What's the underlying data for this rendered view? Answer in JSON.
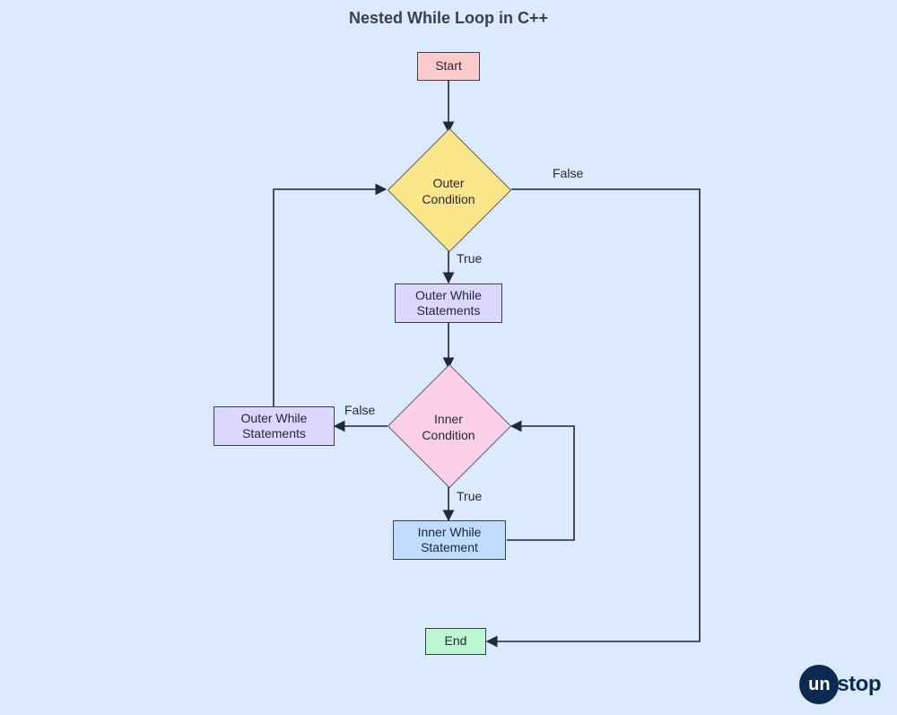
{
  "title": "Nested While Loop in C++",
  "nodes": {
    "start": "Start",
    "outer_condition": "Outer\nCondition",
    "outer_while_stmts_top": "Outer While\nStatements",
    "inner_condition": "Inner\nCondition",
    "outer_while_stmts_left": "Outer While\nStatements",
    "inner_while_stmt": "Inner While\nStatement",
    "end": "End"
  },
  "edges": {
    "outer_true": "True",
    "outer_false": "False",
    "inner_true": "True",
    "inner_false": "False"
  },
  "branding": {
    "circle": "un",
    "text": "stop"
  }
}
